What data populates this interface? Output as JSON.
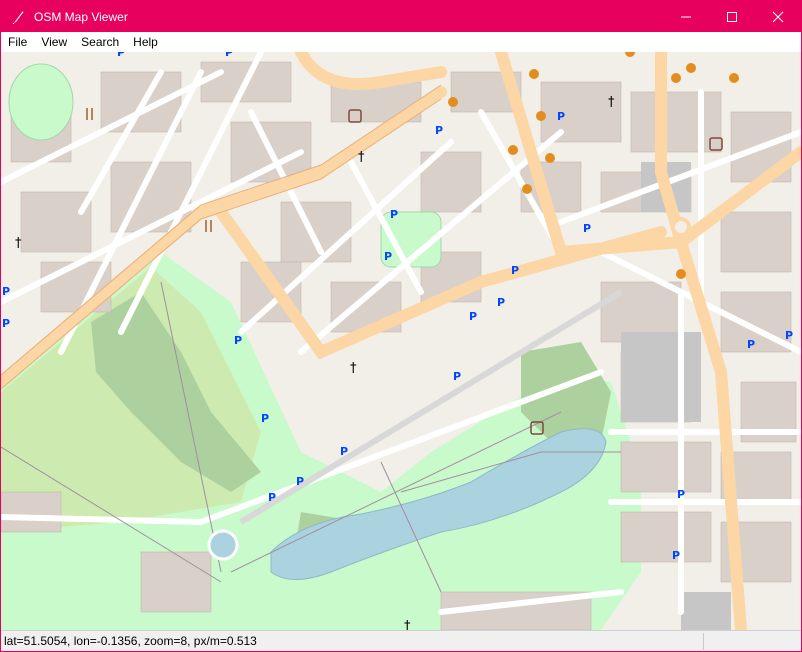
{
  "window": {
    "title": "OSM Map Viewer",
    "title_bar_color": "#e8005e"
  },
  "menu": {
    "items": [
      "File",
      "View",
      "Search",
      "Help"
    ]
  },
  "map": {
    "latitude": 51.5054,
    "longitude": -0.1356,
    "zoom": 8,
    "pixels_per_meter": 0.513,
    "colors": {
      "land": "#f2efe9",
      "building": "#d9d0c9",
      "park": "#c8facc",
      "woodland": "#add19e",
      "water": "#aad3df",
      "primary_road": "#fcd6a4",
      "minor_road": "#ffffff",
      "parking_label": "#0046ff"
    },
    "parking_symbol": "P",
    "place_of_worship_symbol": "†"
  },
  "status": {
    "text": "lat=51.5054, lon=-0.1356, zoom=8, px/m=0.513"
  }
}
